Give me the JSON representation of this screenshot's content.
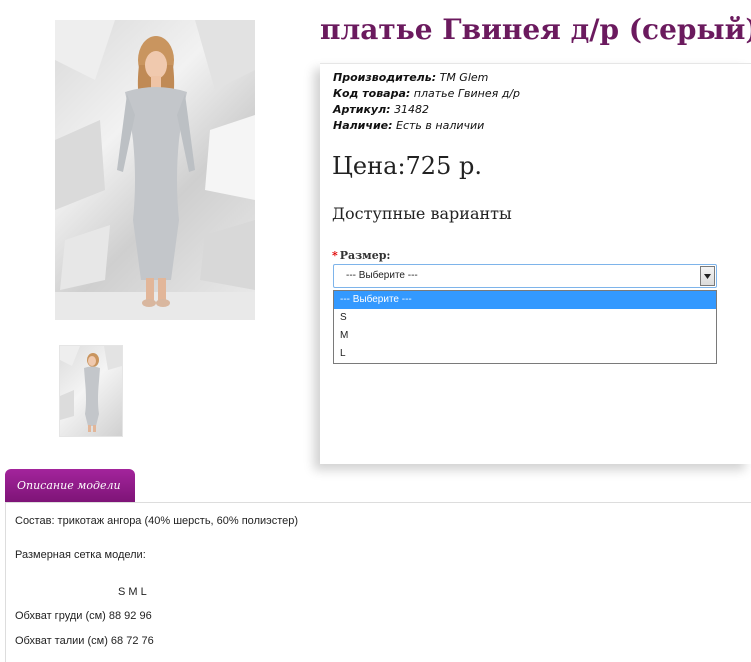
{
  "product": {
    "title": "платье Гвинея д/р (серый)",
    "specs": [
      {
        "key": "Производитель:",
        "value": "TM Glem"
      },
      {
        "key": "Код товара:",
        "value": "платье Гвинея д/р"
      },
      {
        "key": "Артикул:",
        "value": "31482"
      },
      {
        "key": "Наличие:",
        "value": "Есть в наличии"
      }
    ],
    "price": "Цена:725 р."
  },
  "variants": {
    "title": "Доступные варианты",
    "required_mark": "*",
    "size_label": "Размер:",
    "selected_value": "--- Выберите ---",
    "options": [
      "--- Выберите ---",
      "S",
      "M",
      "L"
    ]
  },
  "tabs": [
    {
      "label": "Описание модели",
      "active": true
    }
  ],
  "description": {
    "composition": "Состав: трикотаж ангора (40% шерсть, 60% полиэстер)",
    "size_grid_title": "Размерная сетка модели:",
    "size_header": "S  M  L",
    "rows": [
      "Обхват груди (см) 88 92 96",
      "Обхват талии (см) 68 72 76"
    ]
  },
  "colors": {
    "title": "#6b1a5e",
    "tab_bg": "#8f1b88",
    "select_highlight": "#3399ff",
    "select_border": "#7eb4ea",
    "required": "#e00000",
    "dress": "#c3c6ca",
    "background_wall": "#e6e6e6"
  },
  "icons": {
    "select_arrow": "triangle-down-icon"
  }
}
